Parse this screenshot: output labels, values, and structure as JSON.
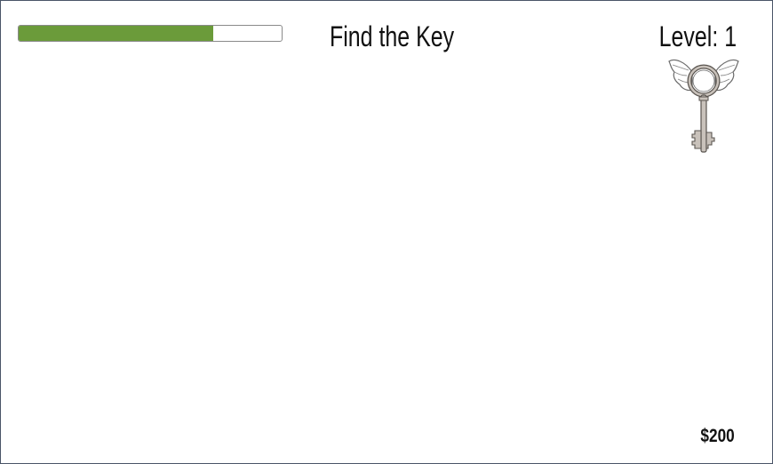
{
  "hud": {
    "title": "Find the Key",
    "level_text": "Level: 1",
    "money_text": "$200",
    "progress": 0.74,
    "progress_color": "#6b9b3a",
    "target_icon": "winged-key-icon"
  }
}
